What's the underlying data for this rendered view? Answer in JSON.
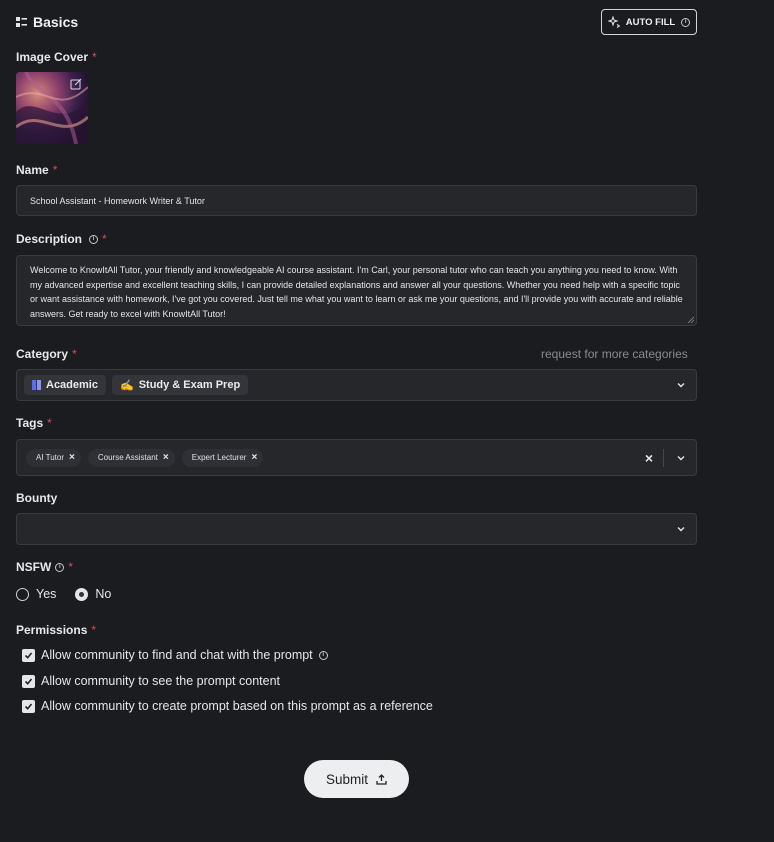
{
  "header": {
    "section_title": "Basics",
    "autofill_label": "AUTO FILL"
  },
  "image_cover": {
    "label": "Image Cover",
    "required_mark": "*"
  },
  "name": {
    "label": "Name",
    "required_mark": "*",
    "value": "School Assistant - Homework Writer & Tutor"
  },
  "description": {
    "label": "Description",
    "required_mark": "*",
    "value": "Welcome to KnowItAll Tutor, your friendly and knowledgeable AI course assistant. I'm Carl, your personal tutor who can teach you anything you need to know. With my advanced expertise and excellent teaching skills, I can provide detailed explanations and answer all your questions. Whether you need help with a specific topic or want assistance with homework, I've got you covered. Just tell me what you want to learn or ask me your questions, and I'll provide you with accurate and reliable answers. Get ready to excel with KnowItAll Tutor!"
  },
  "category": {
    "label": "Category",
    "required_mark": "*",
    "request_link": "request for more categories",
    "selected": [
      {
        "label": "Academic",
        "icon": "book-icon"
      },
      {
        "label": "Study & Exam Prep",
        "icon": "writing-hand-icon",
        "emoji": "✍️"
      }
    ]
  },
  "tags": {
    "label": "Tags",
    "required_mark": "*",
    "items": [
      "AI Tutor",
      "Course Assistant",
      "Expert Lecturer"
    ]
  },
  "bounty": {
    "label": "Bounty",
    "value": ""
  },
  "nsfw": {
    "label": "NSFW",
    "required_mark": "*",
    "options": [
      "Yes",
      "No"
    ],
    "selected": "No"
  },
  "permissions": {
    "label": "Permissions",
    "required_mark": "*",
    "items": [
      {
        "label": "Allow community to find and chat with the prompt",
        "checked": true
      },
      {
        "label": "Allow community to see the prompt content",
        "checked": true
      },
      {
        "label": "Allow community to create prompt based on this prompt as a reference",
        "checked": true
      }
    ]
  },
  "submit": {
    "label": "Submit"
  },
  "colors": {
    "background": "#1b1c1f",
    "field": "#26272b",
    "required": "#e5484d",
    "submit_bg": "#eceef0"
  }
}
